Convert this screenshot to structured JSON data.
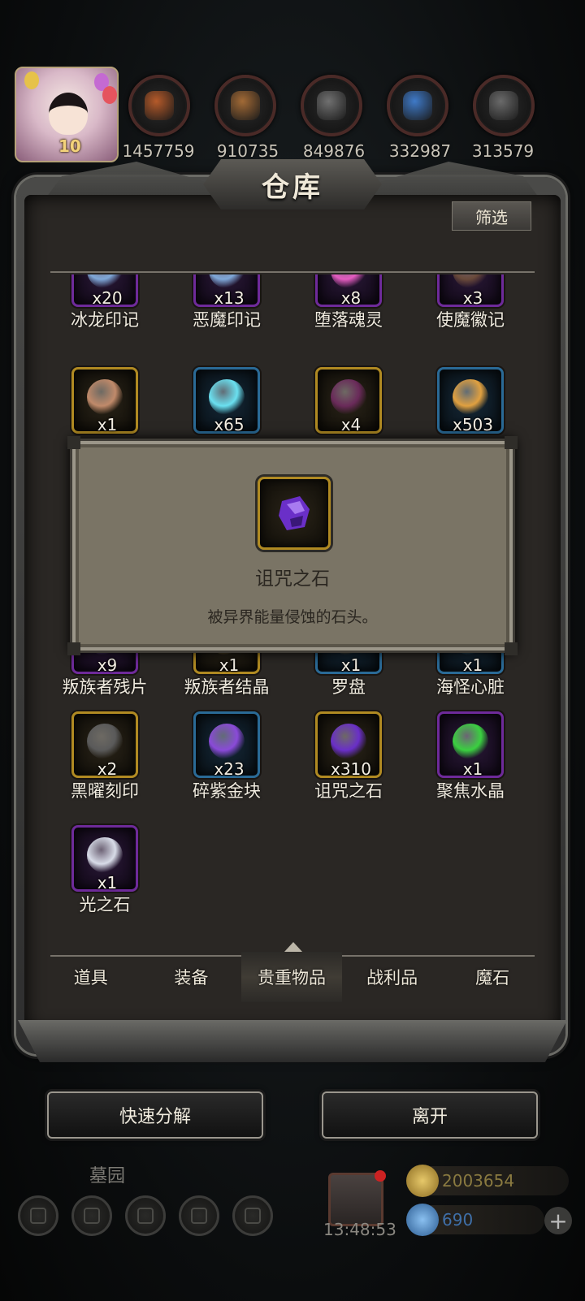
{
  "header": {
    "level": "10",
    "resources": [
      {
        "icon": "ore-icon",
        "value": "1457759",
        "color": "#b55a2a"
      },
      {
        "icon": "wood-icon",
        "value": "910735",
        "color": "#a26a36"
      },
      {
        "icon": "stone-icon",
        "value": "849876",
        "color": "#707070"
      },
      {
        "icon": "crystal-icon",
        "value": "332987",
        "color": "#3f7ac8"
      },
      {
        "icon": "iron-icon",
        "value": "313579",
        "color": "#6a6a6a"
      }
    ]
  },
  "panel": {
    "title": "仓库",
    "filter_label": "筛选"
  },
  "items": [
    {
      "name": "冰龙印记",
      "qty": "x20",
      "rarity": "purple",
      "art": "swirl-icon"
    },
    {
      "name": "恶魔印记",
      "qty": "x13",
      "rarity": "purple",
      "art": "swirl-icon"
    },
    {
      "name": "堕落魂灵",
      "qty": "x8",
      "rarity": "purple",
      "art": "pink-orb-icon"
    },
    {
      "name": "使魔徽记",
      "qty": "x3",
      "rarity": "purple",
      "art": "emblem-icon"
    },
    {
      "name": "",
      "qty": "x1",
      "rarity": "gold",
      "art": "leaf-icon"
    },
    {
      "name": "",
      "qty": "x65",
      "rarity": "blue",
      "art": "flame-orb-icon"
    },
    {
      "name": "",
      "qty": "x4",
      "rarity": "gold",
      "art": "dark-brick-icon"
    },
    {
      "name": "",
      "qty": "x503",
      "rarity": "blue",
      "art": "golden-orb-icon"
    },
    {
      "name": "叛族者残片",
      "qty": "x9",
      "rarity": "purple",
      "art": "shard-icon"
    },
    {
      "name": "叛族者结晶",
      "qty": "x1",
      "rarity": "gold",
      "art": "crystal-icon"
    },
    {
      "name": "罗盘",
      "qty": "x1",
      "rarity": "blue",
      "art": "compass-icon"
    },
    {
      "name": "海怪心脏",
      "qty": "x1",
      "rarity": "blue",
      "art": "heart-icon"
    },
    {
      "name": "黑曜刻印",
      "qty": "x2",
      "rarity": "gold",
      "art": "obsidian-icon"
    },
    {
      "name": "碎紫金块",
      "qty": "x23",
      "rarity": "blue",
      "art": "purple-gem-icon"
    },
    {
      "name": "诅咒之石",
      "qty": "x310",
      "rarity": "gold",
      "art": "cursed-stone-icon"
    },
    {
      "name": "聚焦水晶",
      "qty": "x1",
      "rarity": "purple",
      "art": "green-orb-icon"
    },
    {
      "name": "光之石",
      "qty": "x1",
      "rarity": "purple",
      "art": "light-stone-icon"
    }
  ],
  "tabs": [
    "道具",
    "装备",
    "贵重物品",
    "战利品",
    "魔石"
  ],
  "active_tab_index": 2,
  "tooltip": {
    "name": "诅咒之石",
    "description": "被异界能量侵蚀的石头。"
  },
  "actions": {
    "quick_dismantle": "快速分解",
    "leave": "离开"
  },
  "footer": {
    "zone": "墓园",
    "timer": "13:48:53",
    "gold": "2003654",
    "gems": "690",
    "plus": "+"
  },
  "colors": {
    "purple_frame": "#6e2a9a",
    "gold_frame": "#b08a22",
    "blue_frame": "#2a6a96",
    "gold_text": "#8a7a40",
    "gem_text": "#3f6fa8"
  }
}
